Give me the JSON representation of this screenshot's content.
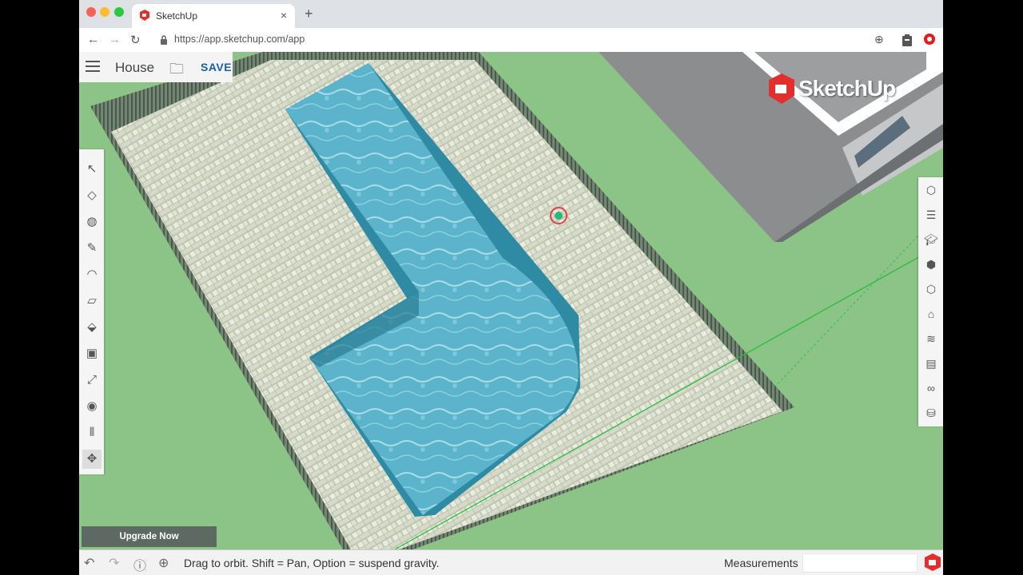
{
  "browser": {
    "tab_title": "SketchUp",
    "url": "https://app.sketchup.com/app",
    "new_tab": "+",
    "close_tab": "×"
  },
  "app": {
    "doc_title": "House",
    "save_label": "SAVE",
    "brand": "SketchUp",
    "upgrade_label": "Upgrade Now"
  },
  "left_tools": [
    "select-icon",
    "eraser-icon",
    "paint-bucket-icon",
    "pencil-icon",
    "arc-icon",
    "rectangle-icon",
    "push-pull-icon",
    "offset-icon",
    "scale-icon",
    "tape-measure-icon",
    "walk-icon",
    "orbit-icon"
  ],
  "right_tools": [
    "entity-info-icon",
    "outliner-icon",
    "instructor-icon",
    "components-icon",
    "materials-icon",
    "styles-icon",
    "layers-icon",
    "scenes-icon",
    "display-icon",
    "model-info-icon"
  ],
  "status": {
    "hint": "Drag to orbit. Shift = Pan, Option = suspend gravity.",
    "measurements_label": "Measurements",
    "measurements_value": ""
  },
  "colors": {
    "ground": "#8cc387",
    "water": "#4fb0c9",
    "paving": "#dfe3d3",
    "brand_red": "#e42e2e"
  }
}
